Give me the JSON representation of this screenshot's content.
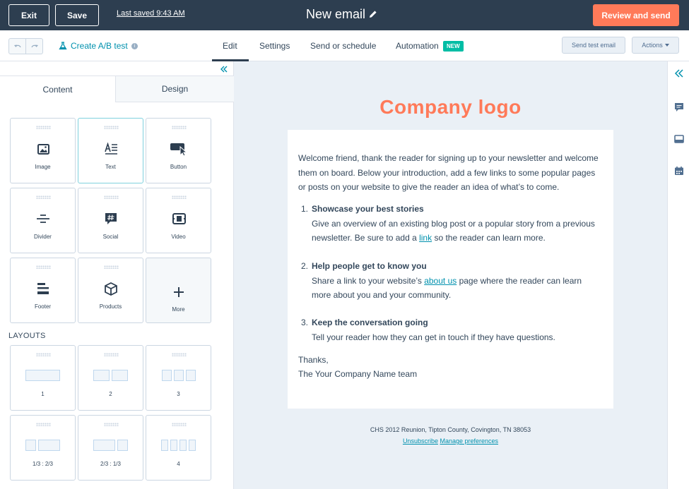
{
  "topbar": {
    "exit_label": "Exit",
    "save_label": "Save",
    "last_saved": "Last saved 9:43 AM",
    "email_title": "New email",
    "review_label": "Review and send"
  },
  "subbar": {
    "ab_test_label": "Create A/B test",
    "tabs": [
      {
        "label": "Edit"
      },
      {
        "label": "Settings"
      },
      {
        "label": "Send or schedule"
      },
      {
        "label": "Automation"
      }
    ],
    "new_badge": "NEW",
    "test_email_label": "Send test email",
    "actions_label": "Actions"
  },
  "leftpanel": {
    "tab_content": "Content",
    "tab_design": "Design",
    "modules": [
      {
        "label": "Image"
      },
      {
        "label": "Text"
      },
      {
        "label": "Button"
      },
      {
        "label": "Divider"
      },
      {
        "label": "Social"
      },
      {
        "label": "Video"
      },
      {
        "label": "Footer"
      },
      {
        "label": "Products"
      },
      {
        "label": "More"
      }
    ],
    "layouts_title": "LAYOUTS",
    "layouts": [
      {
        "label": "1"
      },
      {
        "label": "2"
      },
      {
        "label": "3"
      },
      {
        "label": "1/3 : 2/3"
      },
      {
        "label": "2/3 : 1/3"
      },
      {
        "label": "4"
      }
    ]
  },
  "email": {
    "logo_text": "Company logo",
    "intro": "Welcome friend, thank the reader for signing up to your newsletter and welcome them on board. Below your introduction, add a few links to some popular pages or posts on your website to give the reader an idea of what’s to come.",
    "items": [
      {
        "num": "1.",
        "heading": "Showcase your best stories",
        "pre": "Give an overview of an existing blog post or a popular story from a previous newsletter. Be sure to add a ",
        "link": "link",
        "post": " so the reader can learn more."
      },
      {
        "num": "2.",
        "heading": "Help people get to know you",
        "pre": "Share a link to your website’s ",
        "link": "about us",
        "post": " page where the reader can learn more about you and your community."
      },
      {
        "num": "3.",
        "heading": "Keep the conversation going",
        "pre": "Tell your reader how they can get in touch if they have questions.",
        "link": "",
        "post": ""
      }
    ],
    "thanks": "Thanks,",
    "signoff": "The Your Company Name team",
    "footer_address": "CHS 2012 Reunion, Tipton County, Covington, TN 38053",
    "unsubscribe": "Unsubscribe",
    "manage_prefs": "Manage preferences"
  },
  "colors": {
    "topbar": "#2d3e50",
    "accent": "#ff7a59",
    "link": "#0091ae",
    "badge": "#00bda5"
  }
}
